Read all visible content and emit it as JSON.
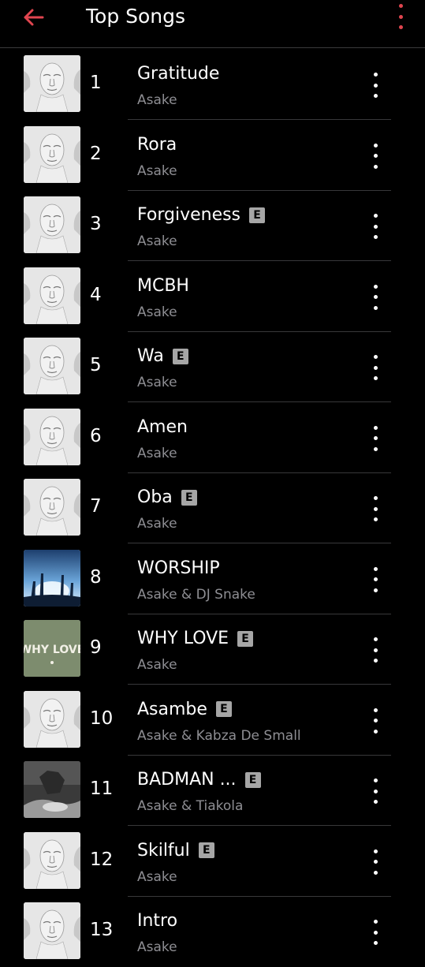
{
  "header": {
    "title": "Top Songs",
    "accent_color": "#e0454f",
    "back_icon": "arrow-left-icon",
    "menu_icon": "more-vertical-icon"
  },
  "songs": [
    {
      "rank": "1",
      "title": "Gratitude",
      "artist": "Asake",
      "explicit": false,
      "art": "asake-face"
    },
    {
      "rank": "2",
      "title": "Rora",
      "artist": "Asake",
      "explicit": false,
      "art": "asake-face"
    },
    {
      "rank": "3",
      "title": "Forgiveness",
      "artist": "Asake",
      "explicit": true,
      "art": "asake-face"
    },
    {
      "rank": "4",
      "title": "MCBH",
      "artist": "Asake",
      "explicit": false,
      "art": "asake-face"
    },
    {
      "rank": "5",
      "title": "Wa",
      "artist": "Asake",
      "explicit": true,
      "art": "asake-face"
    },
    {
      "rank": "6",
      "title": "Amen",
      "artist": "Asake",
      "explicit": false,
      "art": "asake-face"
    },
    {
      "rank": "7",
      "title": "Oba",
      "artist": "Asake",
      "explicit": true,
      "art": "asake-face"
    },
    {
      "rank": "8",
      "title": "WORSHIP",
      "artist": "Asake & DJ Snake",
      "explicit": false,
      "art": "worship-crowd"
    },
    {
      "rank": "9",
      "title": "WHY LOVE",
      "artist": "Asake",
      "explicit": true,
      "art": "why-love",
      "art_text": "WHY LOVE"
    },
    {
      "rank": "10",
      "title": "Asambe",
      "artist": "Asake & Kabza De Small",
      "explicit": true,
      "art": "asake-face"
    },
    {
      "rank": "11",
      "title": "BADMAN ...",
      "artist": "Asake & Tiakola",
      "explicit": true,
      "art": "badman-photo"
    },
    {
      "rank": "12",
      "title": "Skilful",
      "artist": "Asake",
      "explicit": true,
      "art": "asake-face"
    },
    {
      "rank": "13",
      "title": "Intro",
      "artist": "Asake",
      "explicit": false,
      "art": "asake-face"
    }
  ],
  "explicit_label": "E"
}
